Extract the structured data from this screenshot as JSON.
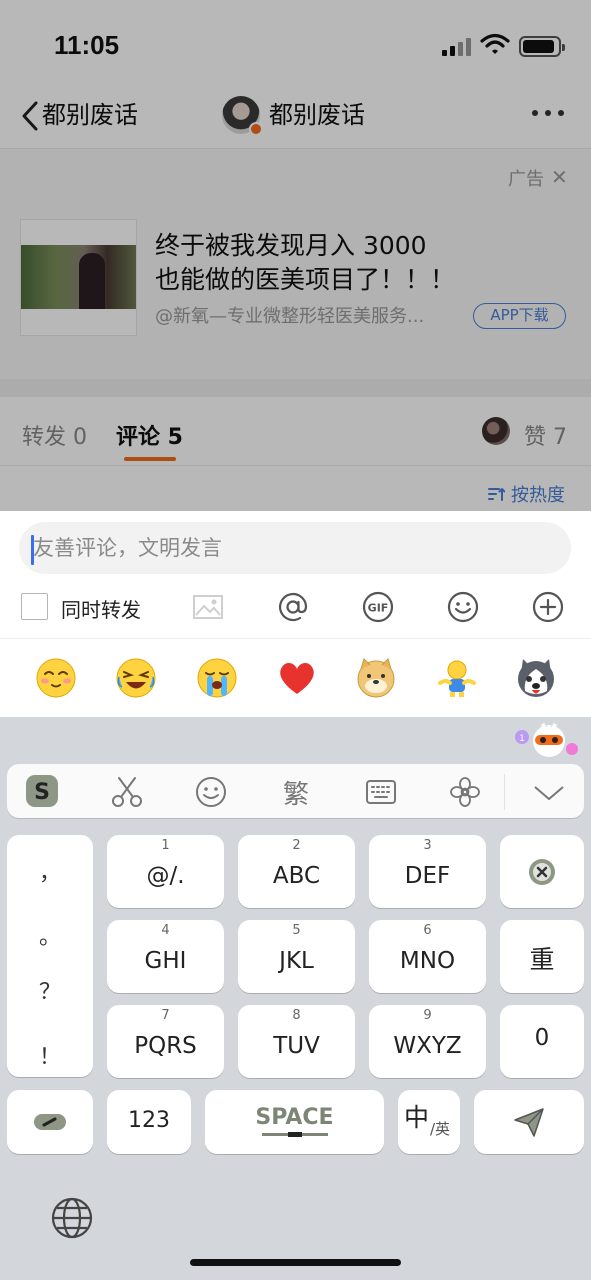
{
  "status": {
    "time": "11:05"
  },
  "nav": {
    "back_label": "都别废话",
    "title": "都别废话"
  },
  "ad": {
    "tag": "广告",
    "close": "✕",
    "title_line1": "终于被我发现月入 3000",
    "title_line2": "也能做的医美项目了！！！",
    "source": "@新氧—专业微整形轻医美服务...",
    "download_label": "APP下载"
  },
  "tabs": {
    "repost": "转发 0",
    "comment": "评论 5",
    "likes": "赞 7",
    "sort": "按热度"
  },
  "composer": {
    "placeholder": "友善评论，文明发言",
    "sync_label": "同时转发",
    "tools": [
      "image-icon",
      "at-icon",
      "gif-icon",
      "emoji-icon",
      "plus-icon"
    ],
    "emojis": [
      "smile-emoji",
      "laugh-cry-emoji",
      "crying-emoji",
      "heart-emoji",
      "doge-emoji",
      "hug-emoji",
      "husky-emoji"
    ]
  },
  "keyboard": {
    "toolbar": [
      "sogou-logo",
      "scissors-icon",
      "smiley-icon",
      "traditional-chinese-toggle",
      "keyboard-icon",
      "flower-icon",
      "collapse-icon"
    ],
    "traditional_label": "繁",
    "punctuation": [
      "，",
      "。",
      "？",
      "！"
    ],
    "keys": [
      {
        "num": "1",
        "label": "@/."
      },
      {
        "num": "2",
        "label": "ABC"
      },
      {
        "num": "3",
        "label": "DEF"
      },
      {
        "num": "4",
        "label": "GHI"
      },
      {
        "num": "5",
        "label": "JKL"
      },
      {
        "num": "6",
        "label": "MNO"
      },
      {
        "num": "7",
        "label": "PQRS"
      },
      {
        "num": "8",
        "label": "TUV"
      },
      {
        "num": "9",
        "label": "WXYZ"
      }
    ],
    "reenter_label": "重",
    "zero_label": "0",
    "numbers_label": "123",
    "space_label": "SPACE",
    "lang_main": "中",
    "lang_sub": "/英"
  },
  "colors": {
    "accent_orange": "#f26b1d",
    "link_blue": "#4a7fd6",
    "caret_blue": "#3c6cf0"
  }
}
